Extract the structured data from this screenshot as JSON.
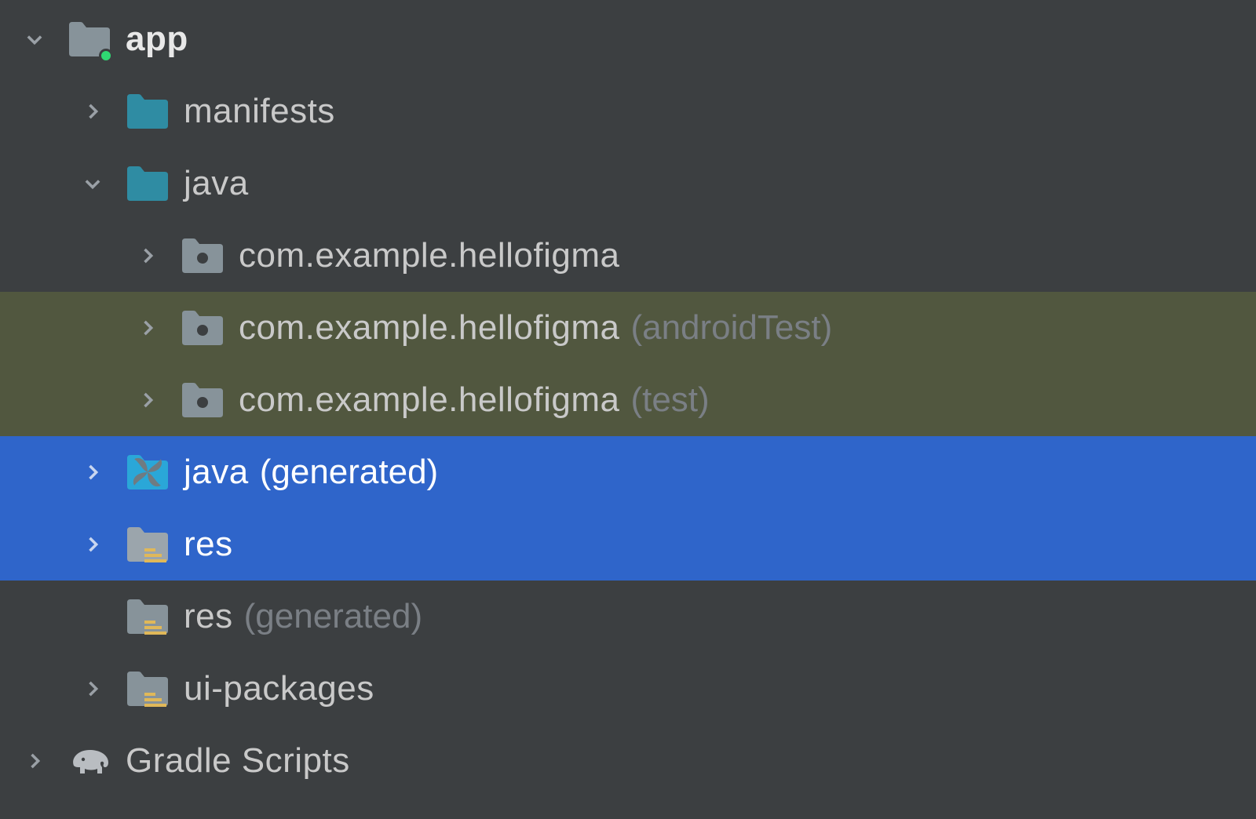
{
  "tree": {
    "app": {
      "label": "app",
      "children": {
        "manifests": {
          "label": "manifests"
        },
        "java": {
          "label": "java",
          "packages": [
            {
              "label": "com.example.hellofigma",
              "suffix": ""
            },
            {
              "label": "com.example.hellofigma",
              "suffix": "(androidTest)"
            },
            {
              "label": "com.example.hellofigma",
              "suffix": "(test)"
            }
          ]
        },
        "java_generated": {
          "label": "java",
          "suffix": "(generated)"
        },
        "res": {
          "label": "res"
        },
        "res_generated": {
          "label": "res",
          "suffix": "(generated)"
        },
        "ui_packages": {
          "label": "ui-packages"
        }
      }
    },
    "gradle": {
      "label": "Gradle Scripts"
    }
  }
}
